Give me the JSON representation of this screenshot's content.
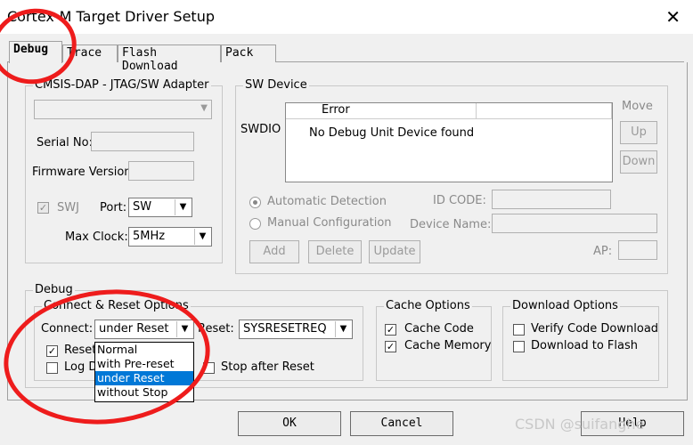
{
  "window": {
    "title": "Cortex-M Target Driver Setup"
  },
  "tabs": [
    {
      "label": "Debug",
      "active": true
    },
    {
      "label": "Trace",
      "active": false
    },
    {
      "label": "Flash Download",
      "active": false
    },
    {
      "label": "Pack",
      "active": false
    }
  ],
  "adapter": {
    "group_label": "CMSIS-DAP - JTAG/SW Adapter",
    "serial_label": "Serial No:",
    "firmware_label": "Firmware Version:",
    "swj_label": "SWJ",
    "port_label": "Port:",
    "port_value": "SW",
    "maxclock_label": "Max Clock:",
    "maxclock_value": "5MHz"
  },
  "swdevice": {
    "group_label": "SW Device",
    "swdio_label": "SWDIO",
    "error_header": "Error",
    "error_message": "No Debug Unit Device found",
    "move_label": "Move",
    "up_label": "Up",
    "down_label": "Down",
    "auto_detect_label": "Automatic Detection",
    "manual_config_label": "Manual Configuration",
    "idcode_label": "ID CODE:",
    "devicename_label": "Device Name:",
    "add_label": "Add",
    "delete_label": "Delete",
    "update_label": "Update",
    "ap_label": "AP:"
  },
  "debug": {
    "group_label": "Debug",
    "connect_reset": {
      "group_label": "Connect & Reset Options",
      "connect_label": "Connect:",
      "connect_value": "under Reset",
      "reset_label": "Reset:",
      "reset_value": "SYSRESETREQ",
      "reset_after_label": "Reset after Connect",
      "log_label": "Log Debug Accesses",
      "stop_after_reset_label": "Stop after Reset"
    },
    "connect_options": [
      "Normal",
      "with Pre-reset",
      "under Reset",
      "without Stop"
    ],
    "cache": {
      "group_label": "Cache Options",
      "code_label": "Cache Code",
      "memory_label": "Cache Memory"
    },
    "download": {
      "group_label": "Download Options",
      "verify_label": "Verify Code Download",
      "flash_label": "Download to Flash"
    }
  },
  "footer": {
    "ok_label": "OK",
    "cancel_label": "Cancel",
    "help_label": "Help"
  },
  "watermark": "CSDN @suifanghe"
}
